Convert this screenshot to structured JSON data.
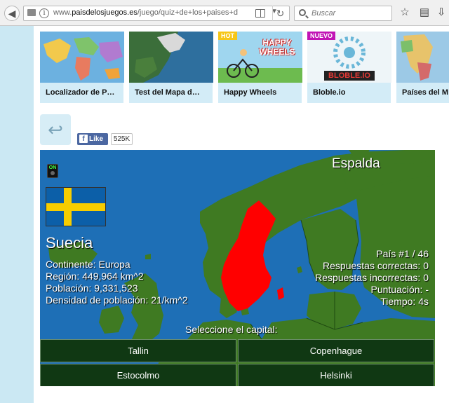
{
  "browser": {
    "url_prefix": "www.",
    "url_domain": "paisdelosjuegos.es",
    "url_path": "/juego/quiz+de+los+paises+d",
    "search_placeholder": "Buscar"
  },
  "thumbnails": [
    {
      "title": "Localizador de P…",
      "badge": ""
    },
    {
      "title": "Test del Mapa d…",
      "badge": ""
    },
    {
      "title": "Happy Wheels",
      "badge": "HOT",
      "art_text": "HAPPY WHEELS"
    },
    {
      "title": "Bloble.io",
      "badge": "NUEVO",
      "art_text": "BLOBLE.IO"
    },
    {
      "title": "Países del M",
      "badge": ""
    }
  ],
  "social": {
    "like_label": "Like",
    "like_count": "525K"
  },
  "game": {
    "sound_label": "ON",
    "solution_label": "Espalda",
    "country_name": "Suecia",
    "info": [
      "Continente: Europa",
      "Región: 449,964 km^2",
      "Población: 9,331,523",
      "Densidad de población: 21/km^2"
    ],
    "stats": [
      "País #1 / 46",
      "Respuestas correctas: 0",
      "Respuestas incorrectas: 0",
      "Puntuación: -",
      "Tiempo: 4s"
    ],
    "prompt": "Seleccione el capital:",
    "answers": [
      "Tallin",
      "Copenhague",
      "Estocolmo",
      "Helsinki"
    ],
    "colors": {
      "ocean": "#1e6fb6",
      "land": "#3f7a22",
      "highlight": "#ff0000",
      "answer_bg": "#103813"
    }
  }
}
